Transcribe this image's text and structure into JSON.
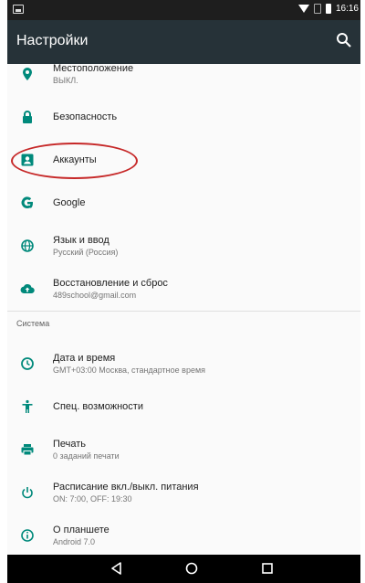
{
  "status_bar": {
    "time": "16:16"
  },
  "app_bar": {
    "title": "Настройки",
    "search_icon": "search-icon"
  },
  "items": [
    {
      "title": "Местоположение",
      "subtitle": "ВЫКЛ.",
      "icon": "location-icon"
    },
    {
      "title": "Безопасность",
      "icon": "lock-icon"
    },
    {
      "title": "Аккаунты",
      "icon": "account-icon"
    },
    {
      "title": "Google",
      "icon": "google-icon"
    },
    {
      "title": "Язык и ввод",
      "subtitle": "Русский (Россия)",
      "icon": "globe-icon"
    },
    {
      "title": "Восстановление и сброс",
      "subtitle": "489school@gmail.com",
      "icon": "cloud-upload-icon"
    }
  ],
  "section_system": "Система",
  "system_items": [
    {
      "title": "Дата и время",
      "subtitle": "GMT+03:00 Москва, стандартное время",
      "icon": "clock-icon"
    },
    {
      "title": "Спец. возможности",
      "icon": "accessibility-icon"
    },
    {
      "title": "Печать",
      "subtitle": "0 заданий печати",
      "icon": "print-icon"
    },
    {
      "title": "Расписание вкл./выкл. питания",
      "subtitle": "ON: 7:00, OFF: 19:30",
      "icon": "power-icon"
    },
    {
      "title": "О планшете",
      "subtitle": "Android 7.0",
      "icon": "info-icon"
    }
  ],
  "colors": {
    "accent": "#00897b",
    "app_bar": "#263238",
    "status_bar": "#1e1e1e",
    "highlight": "#c62828"
  }
}
